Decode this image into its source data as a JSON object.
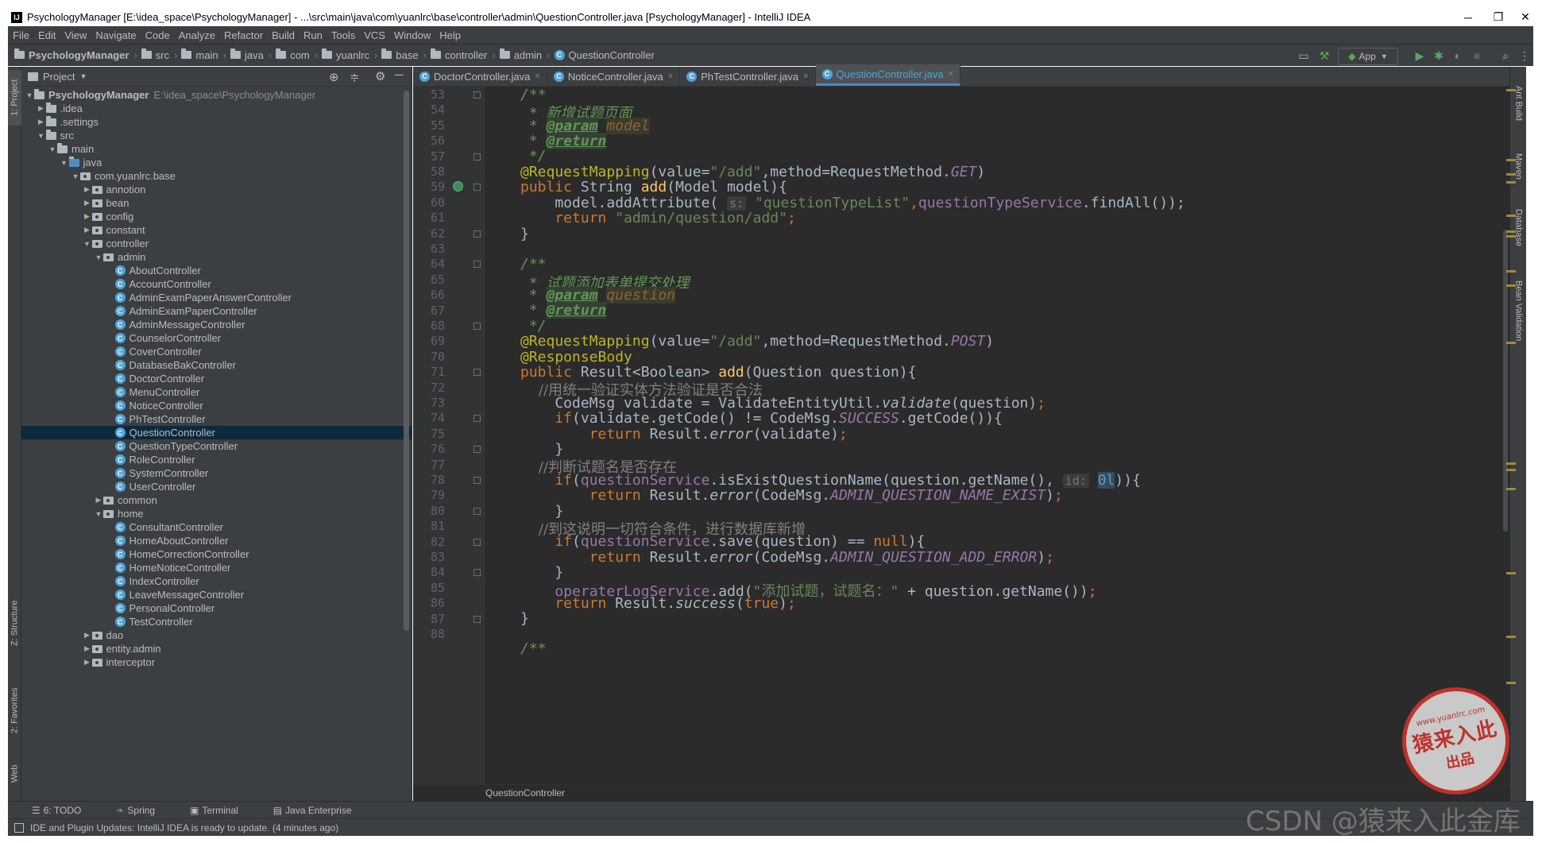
{
  "window": {
    "title": "PsychologyManager [E:\\idea_space\\PsychologyManager] - ...\\src\\main\\java\\com\\yuanlrc\\base\\controller\\admin\\QuestionController.java [PsychologyManager] - IntelliJ IDEA",
    "minimize": "─",
    "restore": "❐",
    "close": "✕",
    "app_icon": "IJ"
  },
  "menu": [
    "File",
    "Edit",
    "View",
    "Navigate",
    "Code",
    "Analyze",
    "Refactor",
    "Build",
    "Run",
    "Tools",
    "VCS",
    "Window",
    "Help"
  ],
  "breadcrumb": [
    "PsychologyManager",
    "src",
    "main",
    "java",
    "com",
    "yuanlrc",
    "base",
    "controller",
    "admin",
    "QuestionController"
  ],
  "toolbar": {
    "run_config": "App"
  },
  "left_strip": {
    "project": "1: Project",
    "structure": "Z: Structure",
    "favorites": "2: Favorites",
    "web": "Web"
  },
  "right_strip": {
    "ant": "Ant Build",
    "maven": "Maven",
    "database": "Database",
    "bean": "Bean Validation"
  },
  "project_panel": {
    "title": "Project",
    "tree": [
      {
        "label": "PsychologyManager",
        "extra": "E:\\idea_space\\PsychologyManager",
        "depth": 0,
        "arrow": "down",
        "type": "module"
      },
      {
        "label": ".idea",
        "depth": 1,
        "arrow": "right",
        "type": "folder"
      },
      {
        "label": ".settings",
        "depth": 1,
        "arrow": "right",
        "type": "folder"
      },
      {
        "label": "src",
        "depth": 1,
        "arrow": "down",
        "type": "folder"
      },
      {
        "label": "main",
        "depth": 2,
        "arrow": "down",
        "type": "folder"
      },
      {
        "label": "java",
        "depth": 3,
        "arrow": "down",
        "type": "srcfolder"
      },
      {
        "label": "com.yuanlrc.base",
        "depth": 4,
        "arrow": "down",
        "type": "package"
      },
      {
        "label": "annotion",
        "depth": 5,
        "arrow": "right",
        "type": "package"
      },
      {
        "label": "bean",
        "depth": 5,
        "arrow": "right",
        "type": "package"
      },
      {
        "label": "config",
        "depth": 5,
        "arrow": "right",
        "type": "package"
      },
      {
        "label": "constant",
        "depth": 5,
        "arrow": "right",
        "type": "package"
      },
      {
        "label": "controller",
        "depth": 5,
        "arrow": "down",
        "type": "package"
      },
      {
        "label": "admin",
        "depth": 6,
        "arrow": "down",
        "type": "package"
      },
      {
        "label": "AboutController",
        "depth": 7,
        "type": "class"
      },
      {
        "label": "AccountController",
        "depth": 7,
        "type": "class"
      },
      {
        "label": "AdminExamPaperAnswerController",
        "depth": 7,
        "type": "class"
      },
      {
        "label": "AdminExamPaperController",
        "depth": 7,
        "type": "class"
      },
      {
        "label": "AdminMessageController",
        "depth": 7,
        "type": "class"
      },
      {
        "label": "CounselorController",
        "depth": 7,
        "type": "class"
      },
      {
        "label": "CoverController",
        "depth": 7,
        "type": "class"
      },
      {
        "label": "DatabaseBakController",
        "depth": 7,
        "type": "class"
      },
      {
        "label": "DoctorController",
        "depth": 7,
        "type": "class"
      },
      {
        "label": "MenuController",
        "depth": 7,
        "type": "class"
      },
      {
        "label": "NoticeController",
        "depth": 7,
        "type": "class"
      },
      {
        "label": "PhTestController",
        "depth": 7,
        "type": "class"
      },
      {
        "label": "QuestionController",
        "depth": 7,
        "type": "class",
        "selected": true
      },
      {
        "label": "QuestionTypeController",
        "depth": 7,
        "type": "class"
      },
      {
        "label": "RoleController",
        "depth": 7,
        "type": "class"
      },
      {
        "label": "SystemController",
        "depth": 7,
        "type": "class"
      },
      {
        "label": "UserController",
        "depth": 7,
        "type": "class"
      },
      {
        "label": "common",
        "depth": 6,
        "arrow": "right",
        "type": "package"
      },
      {
        "label": "home",
        "depth": 6,
        "arrow": "down",
        "type": "package"
      },
      {
        "label": "ConsultantController",
        "depth": 7,
        "type": "class"
      },
      {
        "label": "HomeAboutController",
        "depth": 7,
        "type": "class"
      },
      {
        "label": "HomeCorrectionController",
        "depth": 7,
        "type": "class"
      },
      {
        "label": "HomeNoticeController",
        "depth": 7,
        "type": "class"
      },
      {
        "label": "IndexController",
        "depth": 7,
        "type": "class"
      },
      {
        "label": "LeaveMessageController",
        "depth": 7,
        "type": "class"
      },
      {
        "label": "PersonalController",
        "depth": 7,
        "type": "class"
      },
      {
        "label": "TestController",
        "depth": 7,
        "type": "class"
      },
      {
        "label": "dao",
        "depth": 5,
        "arrow": "right",
        "type": "package"
      },
      {
        "label": "entity.admin",
        "depth": 5,
        "arrow": "right",
        "type": "package"
      },
      {
        "label": "interceptor",
        "depth": 5,
        "arrow": "right",
        "type": "package"
      }
    ]
  },
  "tabs": [
    {
      "label": "DoctorController.java",
      "active": false
    },
    {
      "label": "NoticeController.java",
      "active": false
    },
    {
      "label": "PhTestController.java",
      "active": false
    },
    {
      "label": "QuestionController.java",
      "active": true
    }
  ],
  "editor": {
    "line_numbers": [
      "53",
      "54",
      "55",
      "56",
      "57",
      "58",
      "59",
      "60",
      "61",
      "62",
      "63",
      "64",
      "65",
      "66",
      "67",
      "68",
      "69",
      "70",
      "71",
      "72",
      "73",
      "74",
      "75",
      "76",
      "77",
      "78",
      "79",
      "80",
      "81",
      "82",
      "83",
      "84",
      "85",
      "86",
      "87",
      "88"
    ],
    "t": {
      "c53": "/**",
      "c54a": " * ",
      "c54b": "新增试题页面",
      "c55a": " * ",
      "c55b": "@param",
      "c55c": "model",
      "c56a": " * ",
      "c56b": "@return",
      "c57": " */",
      "c58a": "@RequestMapping",
      "c58b": "(value=",
      "c58c": "\"/add\"",
      "c58d": ",method=RequestMethod.",
      "c58e": "GET",
      "c58f": ")",
      "c59a": "public ",
      "c59b": "String ",
      "c59c": "add",
      "c59d": "(Model model){",
      "c60a": "    model.addAttribute( ",
      "c60b": "s:",
      "c60c": " \"questionTypeList\"",
      "c60d": ",",
      "c60e": "questionTypeService",
      "c60f": ".findAll());",
      "c61a": "    return ",
      "c61b": "\"admin/question/add\"",
      "c61c": ";",
      "c62": "}",
      "c64": "/**",
      "c65a": " * ",
      "c65b": "试题添加表单提交处理",
      "c66a": " * ",
      "c66b": "@param",
      "c66c": "question",
      "c67a": " * ",
      "c67b": "@return",
      "c68": " */",
      "c69a": "@RequestMapping",
      "c69b": "(value=",
      "c69c": "\"/add\"",
      "c69d": ",method=RequestMethod.",
      "c69e": "POST",
      "c69f": ")",
      "c70": "@ResponseBody",
      "c71a": "public ",
      "c71b": "Result<Boolean> ",
      "c71c": "add",
      "c71d": "(Question question){",
      "c72": "    //用统一验证实体方法验证是否合法",
      "c73a": "    CodeMsg validate = ValidateEntityUtil.",
      "c73b": "validate",
      "c73c": "(question)",
      "c73d": ";",
      "c74a": "    if",
      "c74b": "(validate.getCode() != CodeMsg.",
      "c74c": "SUCCESS",
      "c74d": ".getCode()){",
      "c75a": "        return ",
      "c75b": "Result.",
      "c75c": "error",
      "c75d": "(validate)",
      "c75e": ";",
      "c76": "    }",
      "c77": "    //判断试题名是否存在",
      "c78a": "    if",
      "c78b": "(",
      "c78c": "questionService",
      "c78d": ".isExistQuestionName(question.getName(), ",
      "c78e": "id:",
      "c78f": "0l",
      "c78g": ")){",
      "c79a": "        return ",
      "c79b": "Result.",
      "c79c": "error",
      "c79d": "(CodeMsg.",
      "c79e": "ADMIN_QUESTION_NAME_EXIST",
      "c79f": ")",
      "c79g": ";",
      "c80": "    }",
      "c81": "    //到这说明一切符合条件，进行数据库新增",
      "c82a": "    if",
      "c82b": "(",
      "c82c": "questionService",
      "c82d": ".save(question) == ",
      "c82e": "null",
      "c82f": "){",
      "c83a": "        return ",
      "c83b": "Result.",
      "c83c": "error",
      "c83d": "(CodeMsg.",
      "c83e": "ADMIN_QUESTION_ADD_ERROR",
      "c83f": ")",
      "c83g": ";",
      "c84": "    }",
      "c85a": "    ",
      "c85b": "operaterLogService",
      "c85c": ".add(",
      "c85d": "\"添加试题，试题名：\"",
      "c85e": " + question.getName())",
      "c85f": ";",
      "c86a": "    return ",
      "c86b": "Result.",
      "c86c": "success",
      "c86d": "(",
      "c86e": "true",
      "c86f": ")",
      "c86g": ";",
      "c87": "}",
      "c89": "/**"
    }
  },
  "editor_breadcrumb": "QuestionController",
  "bottom_tools": [
    "6: TODO",
    "Spring",
    "Terminal",
    "Java Enterprise"
  ],
  "status": "IDE and Plugin Updates: IntelliJ IDEA is ready to update. (4 minutes ago)",
  "seal": {
    "line1": "www.yuanlrc.com",
    "line2": "猿来入此",
    "line3": "出品"
  },
  "watermark": "CSDN @猿来入此金库",
  "colors": {
    "background": "#2b2b2b",
    "keyword": "#cc7832",
    "string": "#6a8759",
    "comment": "#629755",
    "annotation": "#bbb529",
    "selection": "#0d293e",
    "tab_underline": "#4a88c7"
  }
}
